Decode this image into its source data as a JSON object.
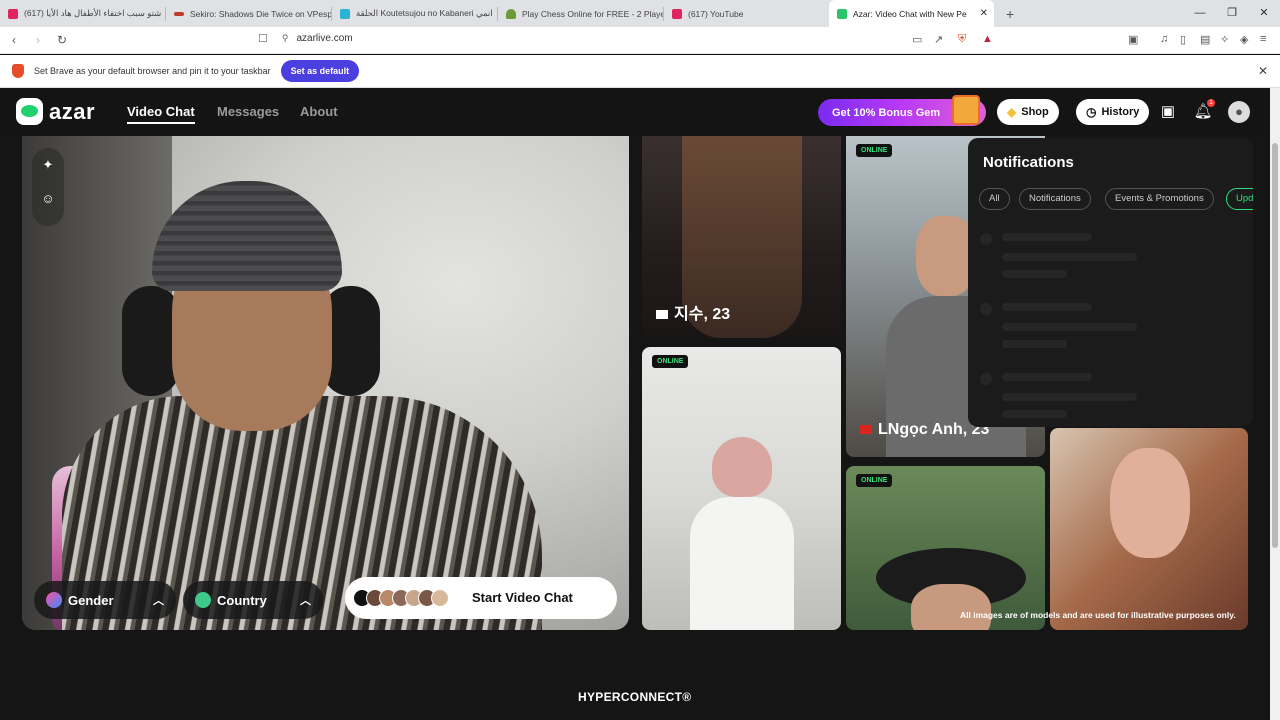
{
  "browser": {
    "tabs": [
      {
        "title": "(617) شتو سبب اختفاء الأطفال هاد الأيا",
        "color": "#e0245e"
      },
      {
        "title": "Sekiro: Shadows Die Twice on VPesp",
        "color": "#c0392b"
      },
      {
        "title": "الحلقة Koutetsujou no Kabaneri انمي",
        "color": "#2ab3d4"
      },
      {
        "title": "Play Chess Online for FREE - 2 Player",
        "color": "#6b9a3a"
      },
      {
        "title": "(617) YouTube",
        "color": "#e0245e"
      },
      {
        "title": "Azar: Video Chat with New Pe",
        "color": "#2bc46a"
      }
    ],
    "new_tab": "+",
    "window_controls": [
      "—",
      "❐",
      "✕"
    ],
    "url": "azarlive.com",
    "infobar": {
      "message": "Set Brave as your default browser and pin it to your taskbar",
      "button": "Set as default",
      "close": "✕"
    }
  },
  "site": {
    "logo": "azar",
    "nav": [
      "Video Chat",
      "Messages",
      "About"
    ],
    "promo": "Get 10% Bonus Gem",
    "shop": "Shop",
    "history": "History",
    "icons": {
      "shop": "gem-icon",
      "history": "clock-icon",
      "store": "store-icon",
      "bell": "bell-icon",
      "avatar": "user-avatar-icon"
    }
  },
  "video": {
    "gender": "Gender",
    "country": "Country",
    "start": "Start Video Chat"
  },
  "cards": {
    "online_label": "ONLINE",
    "jisu": "지수, 23",
    "ngoc": "LNgọc Anh, 23",
    "disclaimer": "All images are of models and are used for illustrative purposes only."
  },
  "notifications": {
    "title": "Notifications",
    "filters": [
      "All",
      "Notifications",
      "Events & Promotions",
      "Upd"
    ]
  },
  "footer": {
    "brand": "HYPERCONNECT®"
  },
  "colors": {
    "accent": "#2be07e",
    "brave_button": "#4c3fe0"
  }
}
